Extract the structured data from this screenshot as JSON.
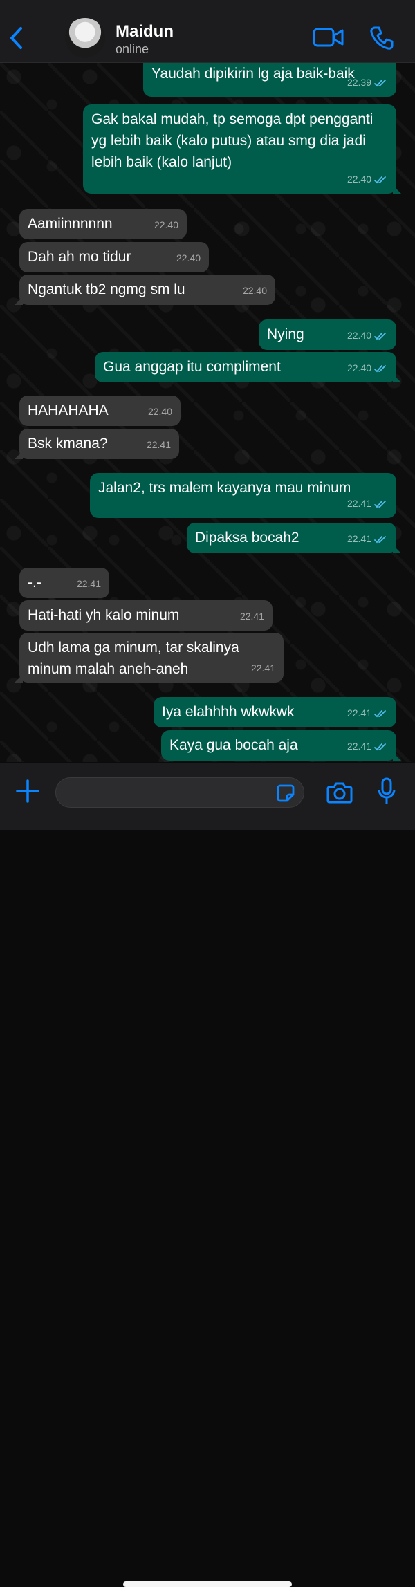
{
  "header": {
    "contact_name": "Maidun",
    "contact_status": "online"
  },
  "colors": {
    "accent": "#0a84ff",
    "outgoing_bubble": "#005c4b",
    "incoming_bubble": "#383838",
    "read_check": "#53bdeb"
  },
  "icons": {
    "back": "chevron-left-icon",
    "video": "video-camera-icon",
    "call": "phone-icon",
    "plus": "plus-icon",
    "sticker": "sticker-icon",
    "camera": "camera-icon",
    "mic": "microphone-icon",
    "read": "double-check-icon"
  },
  "messages": [
    {
      "dir": "out",
      "text": "Yaudah dipikirin lg aja baik-baik",
      "time": "22.39"
    },
    {
      "dir": "out",
      "text": "Gak bakal mudah, tp semoga dpt pengganti yg lebih baik (kalo putus) atau smg dia jadi lebih baik (kalo lanjut)",
      "time": "22.40"
    },
    {
      "dir": "in",
      "text": "Aamiinnnnnn",
      "time": "22.40"
    },
    {
      "dir": "in",
      "text": "Dah ah mo tidur",
      "time": "22.40"
    },
    {
      "dir": "in",
      "text": "Ngantuk tb2 ngmg sm lu",
      "time": "22.40"
    },
    {
      "dir": "out",
      "text": "Nying",
      "time": "22.40"
    },
    {
      "dir": "out",
      "text": "Gua anggap itu compliment",
      "time": "22.40"
    },
    {
      "dir": "in",
      "text": "HAHAHAHA",
      "time": "22.40"
    },
    {
      "dir": "in",
      "text": "Bsk kmana?",
      "time": "22.41"
    },
    {
      "dir": "out",
      "text": "Jalan2, trs malem kayanya mau minum",
      "time": "22.41"
    },
    {
      "dir": "out",
      "text": "Dipaksa bocah2",
      "time": "22.41"
    },
    {
      "dir": "in",
      "text": "-.-",
      "time": "22.41"
    },
    {
      "dir": "in",
      "text": "Hati-hati yh kalo minum",
      "time": "22.41"
    },
    {
      "dir": "in",
      "text": "Udh lama ga minum, tar skalinya minum malah aneh-aneh",
      "time": "22.41"
    },
    {
      "dir": "out",
      "text": "Iya elahhhh wkwkwk",
      "time": "22.41"
    },
    {
      "dir": "out",
      "text": "Kaya gua bocah aja",
      "time": "22.41"
    }
  ],
  "composer": {
    "value": "",
    "placeholder": ""
  }
}
